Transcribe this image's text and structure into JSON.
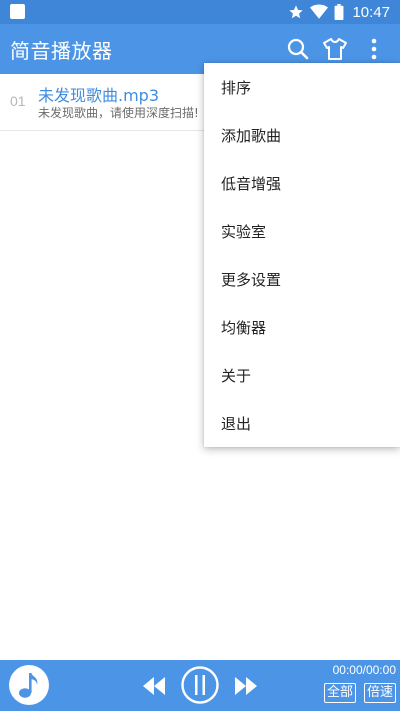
{
  "status_bar": {
    "time": "10:47",
    "icons": [
      "app-notification-icon",
      "star-icon",
      "wifi-icon",
      "battery-icon"
    ]
  },
  "app_bar": {
    "title": "简音播放器",
    "actions": [
      "search-icon",
      "tshirt-icon",
      "more-vert-icon"
    ]
  },
  "song_list": [
    {
      "index": "01",
      "title": "未发现歌曲.mp3",
      "subtitle": "未发现歌曲，请使用深度扫描!"
    }
  ],
  "overflow_menu": {
    "items": [
      "排序",
      "添加歌曲",
      "低音增强",
      "实验室",
      "更多设置",
      "均衡器",
      "关于",
      "退出"
    ]
  },
  "player": {
    "time": "00:00/00:00",
    "scope_label": "全部",
    "speed_label": "倍速",
    "controls": [
      "music-note-icon",
      "previous-icon",
      "pause-icon",
      "next-icon"
    ]
  },
  "colors": {
    "primary": "#4c95e6",
    "status_bar": "#3f86d9",
    "song_title": "#3f8de0"
  }
}
